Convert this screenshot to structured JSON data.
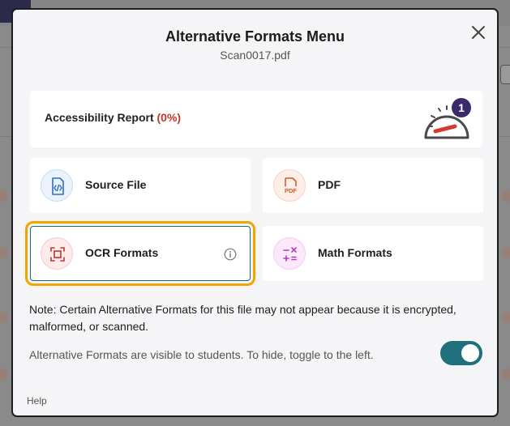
{
  "modal": {
    "title": "Alternative Formats Menu",
    "filename": "Scan0017.pdf",
    "close_icon": "close-icon"
  },
  "report": {
    "label": "Accessibility Report",
    "percent": "(0%)",
    "percent_value": 0,
    "badge_count": "1",
    "icon": "gauge-icon"
  },
  "formats": {
    "source": {
      "label": "Source File",
      "icon": "code-file-icon"
    },
    "pdf": {
      "label": "PDF",
      "icon": "pdf-file-icon"
    },
    "ocr": {
      "label": "OCR Formats",
      "icon": "ocr-scan-icon",
      "info_icon": "info-icon"
    },
    "math": {
      "label": "Math Formats",
      "icon": "math-operators-icon"
    }
  },
  "note": "Note: Certain Alternative Formats for this file may not appear because it is encrypted, malformed, or scanned.",
  "visibility": {
    "text": "Alternative Formats are visible to students. To hide, toggle to the left.",
    "toggle_on": true
  },
  "help": "Help",
  "colors": {
    "accent": "#1f6f7d",
    "focus": "#f0a500",
    "danger": "#c0392b",
    "badge": "#3b2a6b"
  }
}
